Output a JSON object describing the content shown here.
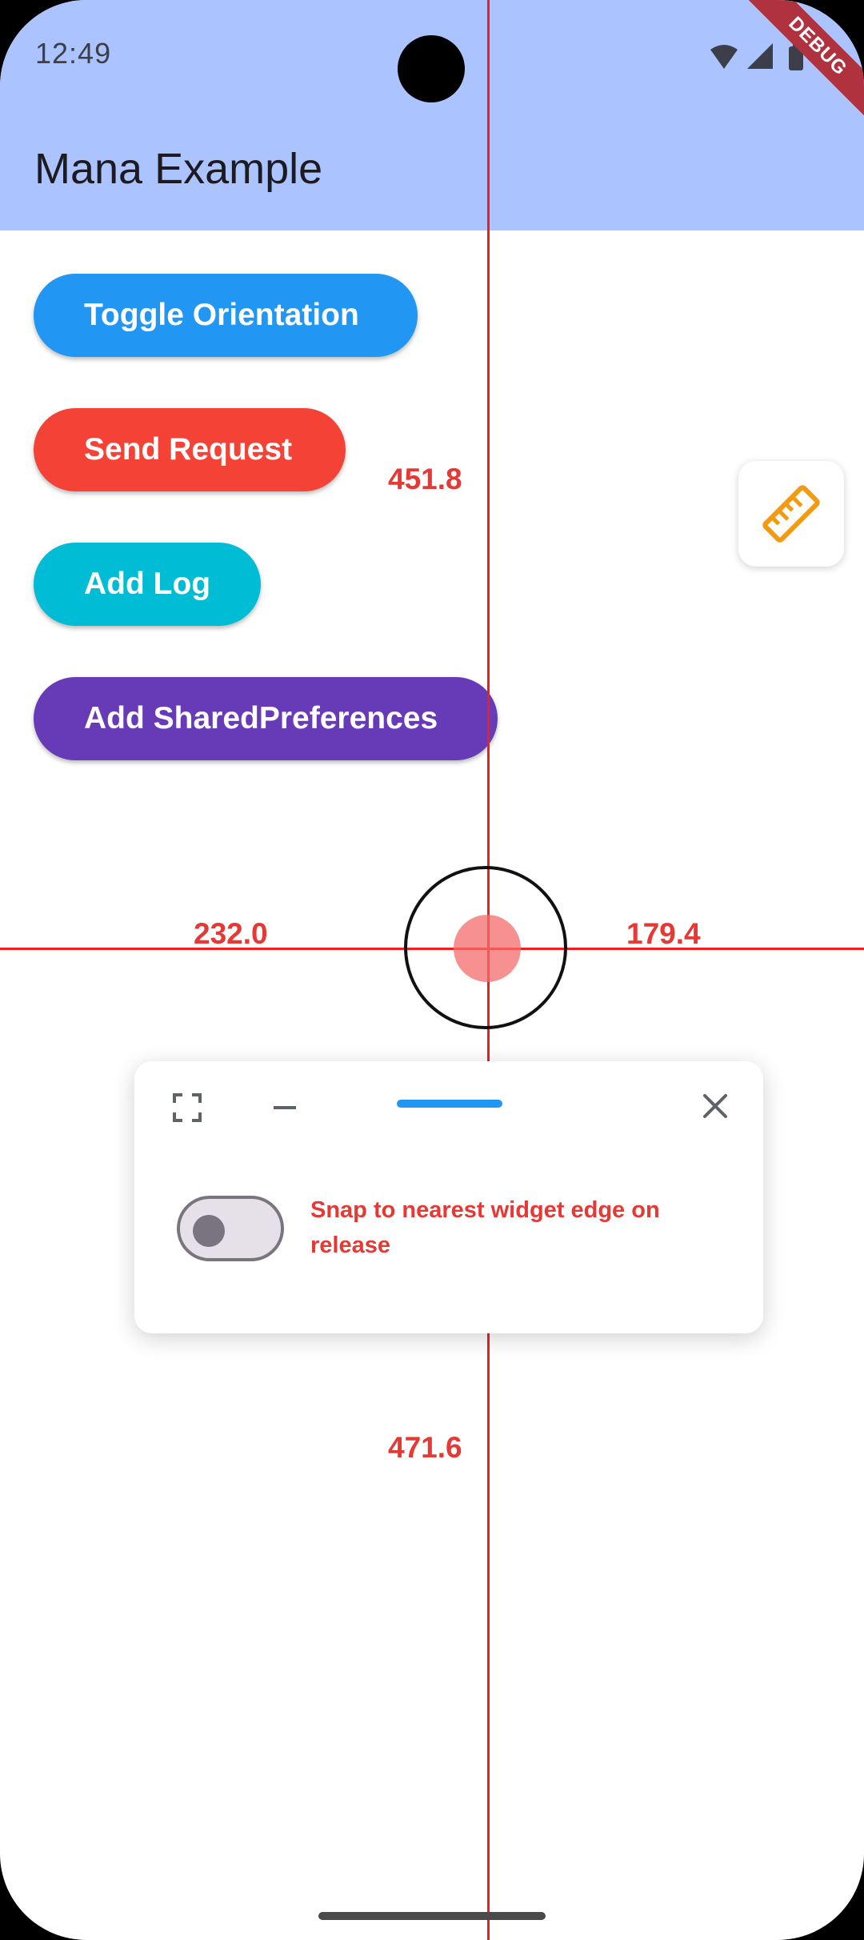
{
  "status_bar": {
    "time": "12:49",
    "icons": [
      "wifi-icon",
      "signal-icon",
      "battery-icon"
    ]
  },
  "debug_banner": "DEBUG",
  "app_bar": {
    "title": "Mana Example",
    "background": "#abc4ff"
  },
  "buttons": [
    {
      "label": "Toggle Orientation",
      "color": "#2196f3"
    },
    {
      "label": "Send Request",
      "color": "#f44336"
    },
    {
      "label": "Add Log",
      "color": "#00bcd4"
    },
    {
      "label": "Add SharedPreferences",
      "color": "#673ab7"
    }
  ],
  "ruler_tool": {
    "icon": "ruler-icon",
    "color": "#f29b12"
  },
  "measurements": {
    "top": "451.8",
    "left": "232.0",
    "right": "179.4",
    "bottom": "471.6",
    "color": "#e53935"
  },
  "panel": {
    "icons": [
      "fullscreen-icon",
      "minimize-icon",
      "drag-handle",
      "close-icon"
    ],
    "snap_switch": {
      "on": false,
      "label": "Snap to nearest widget edge on release"
    }
  }
}
